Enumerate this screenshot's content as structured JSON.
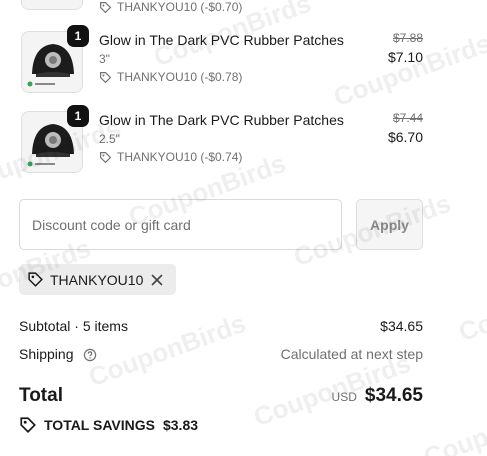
{
  "line_items": [
    {
      "quantity": "1",
      "title": "Glow in The Dark PVC Rubber Patches",
      "variant": "3\"",
      "discount_text": "THANKYOU10 (-$0.78)",
      "original_price": "$7.88",
      "final_price": "$7.10"
    },
    {
      "quantity": "1",
      "title": "Glow in The Dark PVC Rubber Patches",
      "variant": "2.5\"",
      "discount_text": "THANKYOU10 (-$0.74)",
      "original_price": "$7.44",
      "final_price": "$6.70"
    }
  ],
  "partial_item": {
    "discount_text": "THANKYOU10 (-$0.70)"
  },
  "discount_form": {
    "placeholder": "Discount code or gift card",
    "apply_label": "Apply"
  },
  "applied_code": {
    "code": "THANKYOU10"
  },
  "summary": {
    "subtotal_label": "Subtotal · 5 items",
    "subtotal_value": "$34.65",
    "shipping_label": "Shipping",
    "shipping_value": "Calculated at next step",
    "total_label": "Total",
    "currency": "USD",
    "total_value": "$34.65",
    "savings_label": "TOTAL SAVINGS",
    "savings_value": "$3.83"
  },
  "watermark_text": "CouponBirds",
  "icons": {
    "tag": "tag-icon",
    "close": "close-icon",
    "help": "help-circle-icon",
    "savings": "savings-tag-icon"
  }
}
